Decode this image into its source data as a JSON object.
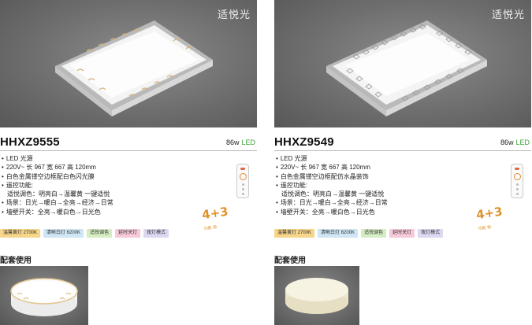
{
  "products": [
    {
      "brand": "适悦光",
      "model": "HHXZ9555",
      "power": "86w",
      "led_label": "LED",
      "specs": [
        {
          "text": "LED 光源",
          "bullet": true
        },
        {
          "text": "220V~ 长 967 宽 667 高 120mm",
          "bullet": true
        },
        {
          "text": "白色金属镂空边框配白色闪光膜",
          "bullet": true
        },
        {
          "text": "遥控功能:",
          "bullet": true
        },
        {
          "text": "适悦调色：明亮白→温馨黄 一键适悦",
          "bullet": false
        },
        {
          "text": "场景：日光→暖白→全亮→经济→日常",
          "bullet": true
        },
        {
          "text": "墙壁开关：全亮→暖白色→日光色",
          "bullet": true
        }
      ],
      "badge_big": "4+3",
      "badge_small": "功能 段",
      "tags": [
        "温馨黄灯 2700K",
        "清晰白灯 6200K",
        "适悦调色",
        "延时关灯",
        "夜灯模式"
      ],
      "section_title": "配套使用"
    },
    {
      "brand": "适悦光",
      "model": "HHXZ9549",
      "power": "86w",
      "led_label": "LED",
      "specs": [
        {
          "text": "LED 光源",
          "bullet": true
        },
        {
          "text": "220V~ 长 967 宽 667 高 120mm",
          "bullet": true
        },
        {
          "text": "白色金属镂空边框配仿水晶装饰",
          "bullet": true
        },
        {
          "text": "遥控功能:",
          "bullet": true
        },
        {
          "text": "适悦调色：明亮白→温馨黄 一键适悦",
          "bullet": false
        },
        {
          "text": "场景：日光→暖白→全亮→经济→日常",
          "bullet": true
        },
        {
          "text": "墙壁开关：全亮→暖白色→日光色",
          "bullet": true
        }
      ],
      "badge_big": "4+3",
      "badge_small": "功能 段",
      "tags": [
        "温馨黄灯 2700K",
        "清晰白灯 6200K",
        "适悦调色",
        "延时关灯",
        "夜灯模式"
      ],
      "section_title": "配套使用"
    }
  ]
}
